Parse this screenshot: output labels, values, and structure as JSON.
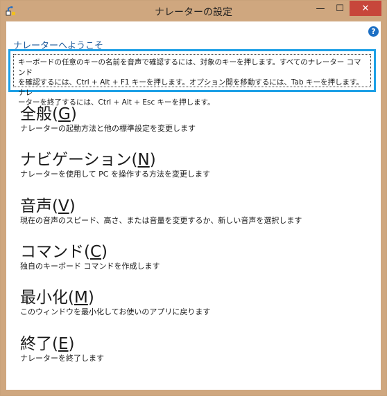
{
  "window": {
    "title": "ナレーターの設定",
    "minimize_glyph": "—",
    "maximize_glyph": "☐",
    "close_glyph": "✕"
  },
  "help": {
    "glyph": "?"
  },
  "welcome_link": "ナレーターへようこそ",
  "info": {
    "line1": "キーボードの任意のキーの名前を音声で確認するには、対象のキーを押します。すべてのナレーター コマンド",
    "line2": "を確認するには、Ctrl + Alt + F1 キーを押します。オプション間を移動するには、Tab キーを押します。ナレ",
    "line3": "ーターを終了するには、Ctrl + Alt + Esc キーを押します。"
  },
  "menu": [
    {
      "title": "全般(",
      "key": "G",
      "close": ")",
      "desc": "ナレーターの起動方法と他の標準設定を変更します"
    },
    {
      "title": "ナビゲーション(",
      "key": "N",
      "close": ")",
      "desc": "ナレーターを使用して PC を操作する方法を変更します"
    },
    {
      "title": "音声(",
      "key": "V",
      "close": ")",
      "desc": "現在の音声のスピード、高さ、または音量を変更するか、新しい音声を選択します"
    },
    {
      "title": "コマンド(",
      "key": "C",
      "close": ")",
      "desc": "独自のキーボード コマンドを作成します"
    },
    {
      "title": "最小化(",
      "key": "M",
      "close": ")",
      "desc": "このウィンドウを最小化してお使いのアプリに戻ります"
    },
    {
      "title": "終了(",
      "key": "E",
      "close": ")",
      "desc": "ナレーターを終了します"
    }
  ],
  "colors": {
    "frame": "#cfa77f",
    "close_button": "#c7463b",
    "focus_border": "#1ea0e6",
    "link": "#1e5a9a"
  }
}
